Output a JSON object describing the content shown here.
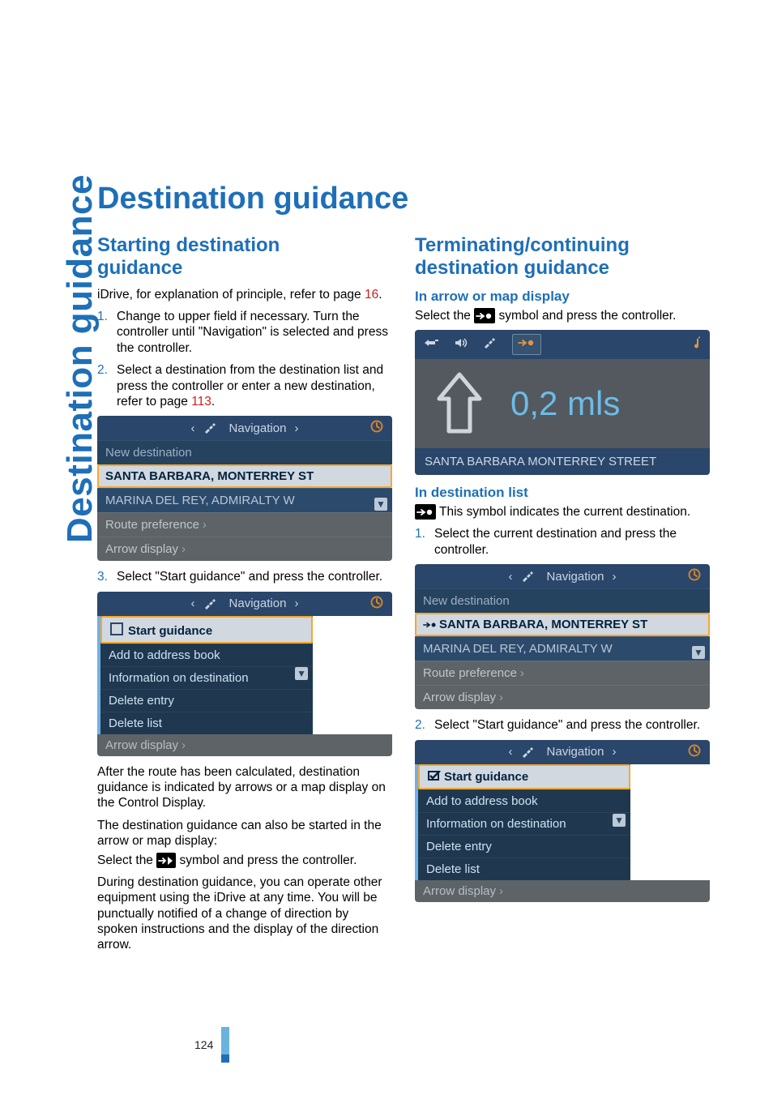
{
  "sidebar_label": "Destination guidance",
  "title": "Destination guidance",
  "left": {
    "h2": "Starting destination\nguidance",
    "intro_a": "iDrive, for explanation of principle, refer to page ",
    "intro_link": "16",
    "intro_b": ".",
    "step1": "Change to upper field if necessary. Turn the controller until \"Navigation\" is selected and press the controller.",
    "step2_a": "Select a destination from the destination list and press the controller or enter a new des­tination, refer to page ",
    "step2_link": "113",
    "step2_b": ".",
    "step3": "Select \"Start guidance\" and press the con­troller.",
    "after_p1": "After the route has been calculated, destination guidance is indicated by arrows or a map dis­play on the Control Display.",
    "after_p2": "The destination guidance can also be started in the arrow or map display:",
    "after_p2b": "Select the ",
    "after_p2c": " symbol and press the controller.",
    "after_p3": "During destination guidance, you can operate other equipment using the iDrive at any time. You will be punctually notified of a change of direction by spoken instructions and the display of the direction arrow."
  },
  "right": {
    "h2": "Terminating/continuing destination guidance",
    "sub1": "In arrow or map display",
    "sub1_p_a": "Select the ",
    "sub1_p_b": " symbol and press the controller.",
    "sub2": "In destination list",
    "sub2_p": " This symbol indicates the current destina­tion.",
    "sub2_step1": "Select the current destination and press the controller.",
    "sub2_step2": "Select \"Start guidance\" and press the con­troller."
  },
  "nav": {
    "header": "Navigation",
    "new_dest": "New destination",
    "sel": "SANTA BARBARA, MONTERREY ST",
    "sub": "MARINA DEL REY, ADMIRALTY W",
    "pref": "Route preference",
    "arrow": "Arrow display",
    "start": "Start guidance",
    "add": "Add to address book",
    "info": "Information on destination",
    "del_entry": "Delete entry",
    "del_list": "Delete list"
  },
  "arrowshot": {
    "dist": "0,2 mls",
    "street": "SANTA BARBARA MONTERREY STREET"
  },
  "page_number": "124"
}
